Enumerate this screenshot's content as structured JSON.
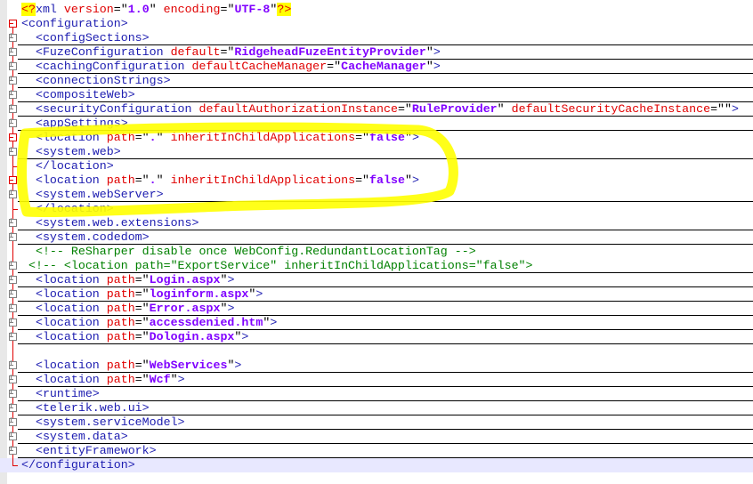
{
  "lines": [
    {
      "fold": "none",
      "tokens": [
        [
          "decl",
          "<?"
        ],
        [
          "tag",
          "xml"
        ],
        [
          "punct",
          " "
        ],
        [
          "attr",
          "version"
        ],
        [
          "punct",
          "=\""
        ],
        [
          "val",
          "1.0"
        ],
        [
          "punct",
          "\" "
        ],
        [
          "attr",
          "encoding"
        ],
        [
          "punct",
          "=\""
        ],
        [
          "val",
          "UTF-8"
        ],
        [
          "punct",
          "\""
        ],
        [
          "decl",
          "?>"
        ]
      ]
    },
    {
      "fold": "open-root",
      "tokens": [
        [
          "tag",
          "<configuration>"
        ]
      ]
    },
    {
      "fold": "plus",
      "tokens": [
        [
          "tag",
          "  <configSections>"
        ]
      ]
    },
    {
      "fold": "plus",
      "tokens": [
        [
          "tag",
          "  <FuzeConfiguration "
        ],
        [
          "attr",
          "default"
        ],
        [
          "punct",
          "=\""
        ],
        [
          "val",
          "RidgeheadFuzeEntityProvider"
        ],
        [
          "punct",
          "\""
        ],
        [
          "tag",
          ">"
        ]
      ]
    },
    {
      "fold": "plus",
      "tokens": [
        [
          "tag",
          "  <cachingConfiguration "
        ],
        [
          "attr",
          "defaultCacheManager"
        ],
        [
          "punct",
          "=\""
        ],
        [
          "val",
          "CacheManager"
        ],
        [
          "punct",
          "\""
        ],
        [
          "tag",
          ">"
        ]
      ]
    },
    {
      "fold": "plus",
      "tokens": [
        [
          "tag",
          "  <connectionStrings>"
        ]
      ]
    },
    {
      "fold": "plus",
      "tokens": [
        [
          "tag",
          "  <compositeWeb>"
        ]
      ]
    },
    {
      "fold": "plus",
      "tokens": [
        [
          "tag",
          "  <securityConfiguration "
        ],
        [
          "attr",
          "defaultAuthorizationInstance"
        ],
        [
          "punct",
          "=\""
        ],
        [
          "val",
          "RuleProvider"
        ],
        [
          "punct",
          "\" "
        ],
        [
          "attr",
          "defaultSecurityCacheInstance"
        ],
        [
          "punct",
          "=\"\""
        ],
        [
          "tag",
          ">"
        ]
      ]
    },
    {
      "fold": "plus",
      "tokens": [
        [
          "tag",
          "  <appSettings>"
        ]
      ]
    },
    {
      "fold": "minus",
      "tokens": [
        [
          "tag",
          "  <location "
        ],
        [
          "attr",
          "path"
        ],
        [
          "punct",
          "=\""
        ],
        [
          "val",
          "."
        ],
        [
          "punct",
          "\" "
        ],
        [
          "attr",
          "inheritInChildApplications"
        ],
        [
          "punct",
          "=\""
        ],
        [
          "val",
          "false"
        ],
        [
          "punct",
          "\""
        ],
        [
          "tag",
          ">"
        ]
      ]
    },
    {
      "fold": "plus",
      "tokens": [
        [
          "tag",
          "  <system.web>"
        ]
      ]
    },
    {
      "fold": "end-inner",
      "tokens": [
        [
          "tag",
          "  </location>"
        ]
      ]
    },
    {
      "fold": "minus",
      "tokens": [
        [
          "tag",
          "  <location "
        ],
        [
          "attr",
          "path"
        ],
        [
          "punct",
          "=\""
        ],
        [
          "val",
          "."
        ],
        [
          "punct",
          "\" "
        ],
        [
          "attr",
          "inheritInChildApplications"
        ],
        [
          "punct",
          "=\""
        ],
        [
          "val",
          "false"
        ],
        [
          "punct",
          "\""
        ],
        [
          "tag",
          ">"
        ]
      ]
    },
    {
      "fold": "plus",
      "tokens": [
        [
          "tag",
          "  <system.webServer>"
        ]
      ]
    },
    {
      "fold": "end-inner",
      "tokens": [
        [
          "tag",
          "  </location>"
        ]
      ]
    },
    {
      "fold": "plus",
      "tokens": [
        [
          "tag",
          "  <system.web.extensions>"
        ]
      ]
    },
    {
      "fold": "plus",
      "tokens": [
        [
          "tag",
          "  <system.codedom>"
        ]
      ]
    },
    {
      "fold": "none",
      "tokens": [
        [
          "comment",
          "  <!-- ReSharper disable once WebConfig.RedundantLocationTag -->"
        ]
      ]
    },
    {
      "fold": "plus",
      "tokens": [
        [
          "comment",
          " <!-- <location path=\"ExportService\" inheritInChildApplications=\"false\">"
        ]
      ]
    },
    {
      "fold": "plus",
      "tokens": [
        [
          "tag",
          "  <location "
        ],
        [
          "attr",
          "path"
        ],
        [
          "punct",
          "=\""
        ],
        [
          "val",
          "Login.aspx"
        ],
        [
          "punct",
          "\""
        ],
        [
          "tag",
          ">"
        ]
      ]
    },
    {
      "fold": "plus",
      "tokens": [
        [
          "tag",
          "  <location "
        ],
        [
          "attr",
          "path"
        ],
        [
          "punct",
          "=\""
        ],
        [
          "val",
          "loginform.aspx"
        ],
        [
          "punct",
          "\""
        ],
        [
          "tag",
          ">"
        ]
      ]
    },
    {
      "fold": "plus",
      "tokens": [
        [
          "tag",
          "  <location "
        ],
        [
          "attr",
          "path"
        ],
        [
          "punct",
          "=\""
        ],
        [
          "val",
          "Error.aspx"
        ],
        [
          "punct",
          "\""
        ],
        [
          "tag",
          ">"
        ]
      ]
    },
    {
      "fold": "plus",
      "tokens": [
        [
          "tag",
          "  <location "
        ],
        [
          "attr",
          "path"
        ],
        [
          "punct",
          "=\""
        ],
        [
          "val",
          "accessdenied.htm"
        ],
        [
          "punct",
          "\""
        ],
        [
          "tag",
          ">"
        ]
      ]
    },
    {
      "fold": "plus",
      "tokens": [
        [
          "tag",
          "  <location "
        ],
        [
          "attr",
          "path"
        ],
        [
          "punct",
          "=\""
        ],
        [
          "val",
          "Dologin.aspx"
        ],
        [
          "punct",
          "\""
        ],
        [
          "tag",
          ">"
        ]
      ]
    },
    {
      "fold": "none",
      "tokens": []
    },
    {
      "fold": "plus",
      "tokens": [
        [
          "tag",
          "  <location "
        ],
        [
          "attr",
          "path"
        ],
        [
          "punct",
          "=\""
        ],
        [
          "val",
          "WebServices"
        ],
        [
          "punct",
          "\""
        ],
        [
          "tag",
          ">"
        ]
      ]
    },
    {
      "fold": "plus",
      "tokens": [
        [
          "tag",
          "  <location "
        ],
        [
          "attr",
          "path"
        ],
        [
          "punct",
          "=\""
        ],
        [
          "val",
          "Wcf"
        ],
        [
          "punct",
          "\""
        ],
        [
          "tag",
          ">"
        ]
      ]
    },
    {
      "fold": "plus",
      "tokens": [
        [
          "tag",
          "  <runtime>"
        ]
      ]
    },
    {
      "fold": "plus",
      "tokens": [
        [
          "tag",
          "  <telerik.web.ui>"
        ]
      ]
    },
    {
      "fold": "plus",
      "tokens": [
        [
          "tag",
          "  <system.serviceModel>"
        ]
      ]
    },
    {
      "fold": "plus",
      "tokens": [
        [
          "tag",
          "  <system.data>"
        ]
      ]
    },
    {
      "fold": "plus",
      "tokens": [
        [
          "tag",
          "  <entityFramework>"
        ]
      ]
    },
    {
      "fold": "end-root",
      "tokens": [
        [
          "tag",
          "</configuration>"
        ]
      ]
    }
  ],
  "colors": {
    "highlight": "#ffff00",
    "tag": "#1c1cb0",
    "attr": "#e00000",
    "value": "#8000ff",
    "comment": "#008000",
    "fold_line": "#e00000"
  }
}
